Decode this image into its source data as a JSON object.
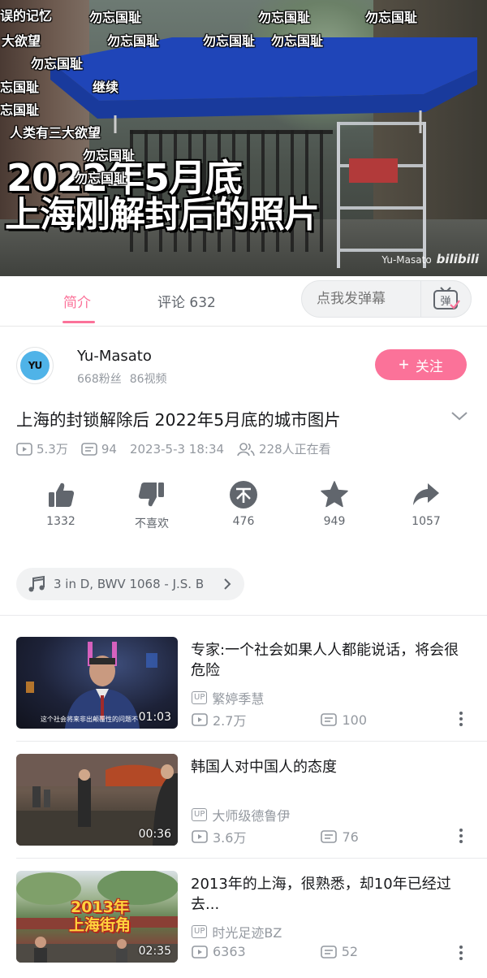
{
  "player": {
    "danmaku": [
      {
        "text": "误的记忆"
      },
      {
        "text": "勿忘国耻"
      },
      {
        "text": "勿忘国耻"
      },
      {
        "text": "勿忘国耻"
      },
      {
        "text": "大欲望"
      },
      {
        "text": "勿忘国耻"
      },
      {
        "text": "勿忘国耻"
      },
      {
        "text": "勿忘国耻"
      },
      {
        "text": "勿忘国耻"
      },
      {
        "text": "忘国耻"
      },
      {
        "text": "继续"
      },
      {
        "text": "忘国耻"
      },
      {
        "text": "人类有三大欲望"
      },
      {
        "text": "勿忘国耻"
      },
      {
        "text": "勿忘国耻"
      }
    ],
    "caption_line1": "2022年5月底",
    "caption_line2": "上海刚解封后的照片",
    "watermark_author": "Yu-Masato",
    "watermark_brand": "bilibili"
  },
  "tabs": {
    "intro_label": "简介",
    "comments_label": "评论 632",
    "danmaku_placeholder": "点我发弹幕",
    "danmaku_toggle_label": "弹"
  },
  "uploader": {
    "avatar_text": "YU",
    "name": "Yu-Masato",
    "fans": "668粉丝",
    "videos": "86视频",
    "follow_label": "关注"
  },
  "video": {
    "title": "上海的封锁解除后 2022年5月底的城市图片",
    "views": "5.3万",
    "danmaku_count": "94",
    "published": "2023-5-3 18:34",
    "watching": "228人正在看"
  },
  "actions": {
    "like_count": "1332",
    "dislike_label": "不喜欢",
    "coin_count": "476",
    "favorite_count": "949",
    "share_count": "1057"
  },
  "bgm": {
    "text": "3 in D, BWV 1068 - J.S. B"
  },
  "recommendations": [
    {
      "title": "专家:一个社会如果人人都能说话，将会很危险",
      "uploader": "繁婷季慧",
      "views": "2.7万",
      "danmaku": "100",
      "duration": "01:03",
      "thumb_caption": "这个社会将来非出颠覆性的问题不"
    },
    {
      "title": "韩国人对中国人的态度",
      "uploader": "大师级德鲁伊",
      "views": "3.6万",
      "danmaku": "76",
      "duration": "00:36"
    },
    {
      "title": "2013年的上海，很熟悉，却10年已经过去...",
      "uploader": "时光足迹BZ",
      "views": "6363",
      "danmaku": "52",
      "duration": "02:35",
      "thumb_caption": "2013年 上海街角"
    }
  ],
  "up_tag": "UP",
  "colors": {
    "accent": "#fb7299",
    "canopy": "#1f45b8",
    "text_secondary": "#9499a0"
  }
}
